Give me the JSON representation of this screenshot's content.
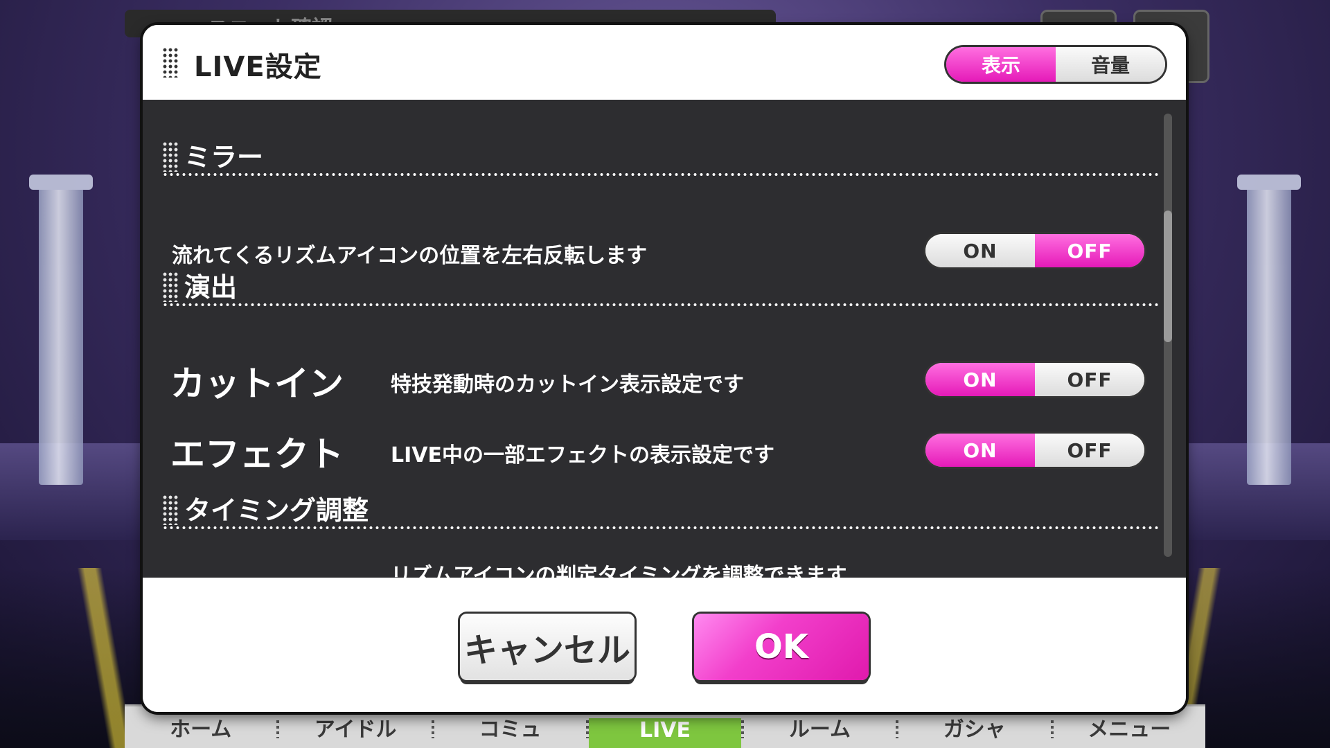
{
  "background": {
    "top_tab_label": "ユニット確認",
    "nav": [
      {
        "label": "ホーム",
        "active": false
      },
      {
        "label": "アイドル",
        "active": false
      },
      {
        "label": "コミュ",
        "active": false
      },
      {
        "label": "LIVE",
        "active": true
      },
      {
        "label": "ルーム",
        "active": false
      },
      {
        "label": "ガシャ",
        "active": false
      },
      {
        "label": "メニュー",
        "active": false
      }
    ]
  },
  "dialog": {
    "title": "LIVE設定",
    "header_tabs": [
      {
        "label": "表示",
        "selected": true
      },
      {
        "label": "音量",
        "selected": false
      }
    ],
    "sections": {
      "mirror": {
        "title": "ミラー",
        "description": "流れてくるリズムアイコンの位置を左右反転します",
        "toggle": {
          "on_label": "ON",
          "off_label": "OFF",
          "value": "OFF"
        }
      },
      "effects": {
        "title": "演出",
        "cutin": {
          "label": "カットイン",
          "description": "特技発動時のカットイン表示設定です",
          "toggle": {
            "on_label": "ON",
            "off_label": "OFF",
            "value": "ON"
          }
        },
        "effect": {
          "label": "エフェクト",
          "description": "LIVE中の一部エフェクトの表示設定です",
          "toggle": {
            "on_label": "ON",
            "off_label": "OFF",
            "value": "ON"
          }
        }
      },
      "timing": {
        "title": "タイミング調整",
        "description": "リズムアイコンの判定タイミングを調整できます"
      }
    },
    "buttons": {
      "cancel": "キャンセル",
      "ok": "OK"
    }
  },
  "colors": {
    "accent_pink": "#e51ab8",
    "panel_dark": "#0a0a0e",
    "nav_active": "#7ec63f"
  }
}
